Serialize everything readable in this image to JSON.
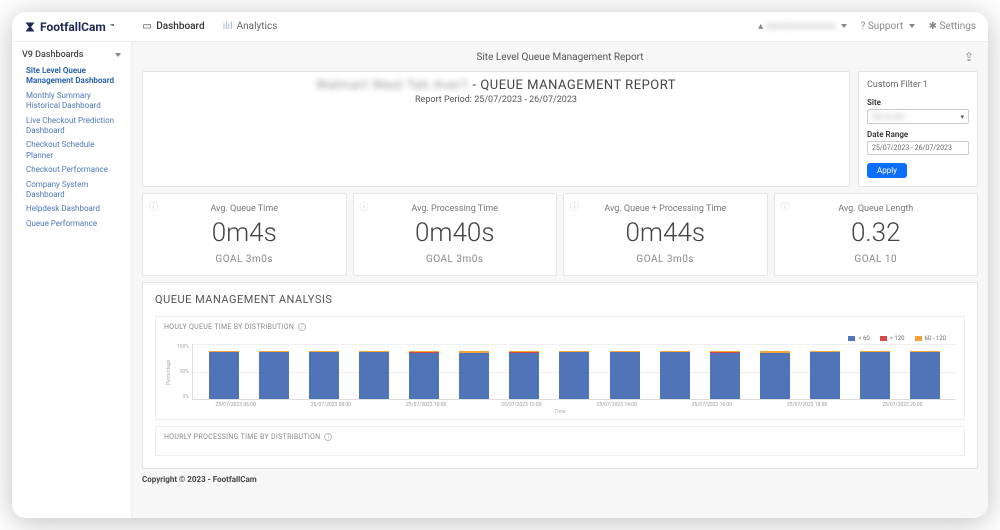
{
  "brand": {
    "name": "FootfallCam",
    "tm": "™"
  },
  "nav": {
    "tabs": [
      {
        "icon": "dashboard-icon",
        "label": "Dashboard",
        "active": true
      },
      {
        "icon": "analytics-icon",
        "label": "Analytics",
        "active": false
      }
    ],
    "user_hidden": "xxxxxxxxxxxxxx",
    "support_label": "Support",
    "settings_label": "Settings"
  },
  "sidebar": {
    "section": "V9 Dashboards",
    "items": [
      {
        "label": "Site Level Queue Management Dashboard",
        "active": true
      },
      {
        "label": "Monthly Summary Historical Dashboard"
      },
      {
        "label": "Live Checkout Prediction Dashboard"
      },
      {
        "label": "Checkout Schedule Planner"
      },
      {
        "label": "Checkout Performance"
      },
      {
        "label": "Company System Dashboard"
      },
      {
        "label": "Helpdesk Dashboard"
      },
      {
        "label": "Queue Performance"
      }
    ]
  },
  "page": {
    "header": "Site Level Queue Management Report",
    "report_site_hidden": "Walmart  West Teh Aver1",
    "report_title_suffix": " -  QUEUE MANAGEMENT REPORT",
    "report_period": "Report Period: 25/07/2023 - 26/07/2023"
  },
  "filter": {
    "title": "Custom Filter 1",
    "site_label": "Site",
    "site_value_hidden": "the la teri",
    "date_label": "Date Range",
    "date_value": "25/07/2023 - 26/07/2023",
    "apply_label": "Apply"
  },
  "kpis": [
    {
      "label": "Avg. Queue Time",
      "value": "0m4s",
      "goal": "GOAL 3m0s"
    },
    {
      "label": "Avg. Processing Time",
      "value": "0m40s",
      "goal": "GOAL 3m0s"
    },
    {
      "label": "Avg. Queue + Processing Time",
      "value": "0m44s",
      "goal": "GOAL 3m0s"
    },
    {
      "label": "Avg. Queue Length",
      "value": "0.32",
      "goal": "GOAL 10"
    }
  ],
  "analysis": {
    "title": "QUEUE MANAGEMENT ANALYSIS",
    "chart1_title": "HOULY QUEUE TIME BY DISTRIBUTION",
    "chart2_title": "HOURLY PROCESSING TIME BY DISTRIBUTION"
  },
  "chart_data": {
    "type": "bar",
    "title": "HOULY QUEUE TIME BY DISTRIBUTION",
    "ylabel": "Percentage",
    "xlabel": "Time",
    "ylim": [
      0,
      100
    ],
    "yticks": [
      0,
      50,
      100
    ],
    "legend": [
      {
        "name": "< 60",
        "color": "#5074b8"
      },
      {
        "name": "> 120",
        "color": "#d94848"
      },
      {
        "name": "60 - 120",
        "color": "#f2a13c"
      }
    ],
    "x_tick_labels": [
      "25/07/2023 06:00",
      "25/07/2023 08:00",
      "25/07/2023 10:00",
      "25/07/2023 12:00",
      "25/07/2023 14:00",
      "25/07/2023 16:00",
      "25/07/2023 18:00",
      "25/07/2023 20:00"
    ],
    "categories": [
      "06:00",
      "07:00",
      "08:00",
      "09:00",
      "10:00",
      "11:00",
      "12:00",
      "13:00",
      "14:00",
      "15:00",
      "16:00",
      "17:00",
      "18:00",
      "19:00",
      "20:00"
    ],
    "series": [
      {
        "name": "< 60",
        "values": [
          97,
          98,
          97,
          98,
          96,
          95,
          96,
          98,
          97,
          98,
          96,
          95,
          97,
          97,
          97
        ]
      },
      {
        "name": "> 120",
        "values": [
          0,
          0,
          0,
          0,
          1,
          1,
          2,
          0,
          0,
          0,
          1,
          1,
          1,
          0,
          0
        ]
      },
      {
        "name": "60 - 120",
        "values": [
          3,
          2,
          3,
          2,
          3,
          4,
          2,
          2,
          3,
          2,
          3,
          4,
          2,
          3,
          3
        ]
      }
    ]
  },
  "footer": {
    "copyright_prefix": "Copyright © 2023 - ",
    "copyright_brand": "FootfallCam"
  }
}
